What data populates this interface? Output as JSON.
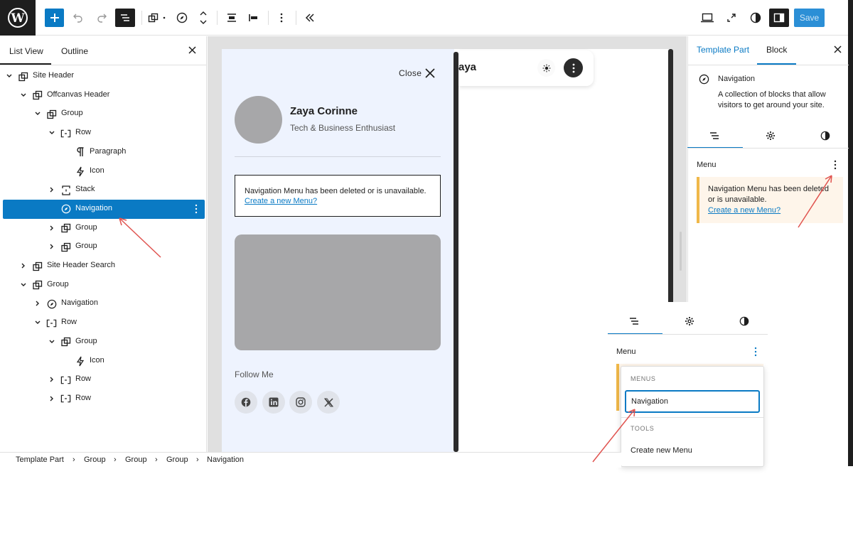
{
  "toolbar": {
    "save_label": "Save",
    "icons": [
      "wordpress-logo-icon",
      "plus-icon",
      "undo-icon",
      "redo-icon",
      "list-view-icon",
      "block-type-icon",
      "navigation-compass-icon",
      "move-arrows-icon",
      "justify-icon",
      "align-icon",
      "more-vertical-icon",
      "collapse-icon",
      "desktop-preview-icon",
      "external-link-icon",
      "contrast-icon",
      "sidebar-icon"
    ]
  },
  "left_panel": {
    "tabs": [
      "List View",
      "Outline"
    ],
    "tree": [
      {
        "label": "Site Header",
        "icon": "template-part-icon",
        "chevron": "down"
      },
      {
        "label": "Offcanvas Header",
        "icon": "group-icon",
        "chevron": "down"
      },
      {
        "label": "Group",
        "icon": "group-icon",
        "chevron": "down"
      },
      {
        "label": "Row",
        "icon": "row-icon",
        "chevron": "down"
      },
      {
        "label": "Paragraph",
        "icon": "paragraph-icon",
        "chevron": ""
      },
      {
        "label": "Icon",
        "icon": "bolt-icon",
        "chevron": ""
      },
      {
        "label": "Stack",
        "icon": "stack-icon",
        "chevron": "right"
      },
      {
        "label": "Navigation",
        "icon": "navigation-compass-icon",
        "chevron": "",
        "selected": true
      },
      {
        "label": "Group",
        "icon": "group-icon",
        "chevron": "right"
      },
      {
        "label": "Group",
        "icon": "group-icon",
        "chevron": "right"
      },
      {
        "label": "Site Header Search",
        "icon": "group-icon",
        "chevron": "right"
      },
      {
        "label": "Group",
        "icon": "group-icon",
        "chevron": "down"
      },
      {
        "label": "Navigation",
        "icon": "navigation-compass-icon",
        "chevron": "right"
      },
      {
        "label": "Row",
        "icon": "row-icon",
        "chevron": "down"
      },
      {
        "label": "Group",
        "icon": "group-icon",
        "chevron": "down"
      },
      {
        "label": "Icon",
        "icon": "bolt-icon",
        "chevron": ""
      },
      {
        "label": "Row",
        "icon": "row-icon",
        "chevron": "right"
      },
      {
        "label": "Row",
        "icon": "row-icon",
        "chevron": "right"
      }
    ]
  },
  "canvas": {
    "header_name": "aya",
    "close_label": "Close",
    "profile_name": "Zaya Corinne",
    "profile_title": "Tech & Business Enthusiast",
    "notice_text": "Navigation Menu has been deleted or is unavailable.",
    "notice_link": "Create a new Menu?",
    "follow_label": "Follow Me",
    "social_icons": [
      "facebook-icon",
      "linkedin-icon",
      "instagram-icon",
      "x-icon"
    ]
  },
  "right_panel": {
    "tabs": [
      "Template Part",
      "Block"
    ],
    "block_title": "Navigation",
    "block_description": "A collection of blocks that allow visitors to get around your site.",
    "menu_label": "Menu",
    "warning_text": "Navigation Menu has been deleted or is unavailable.",
    "warning_link": "Create a new Menu?"
  },
  "popover": {
    "menu_label": "Menu",
    "menus_heading": "MENUS",
    "menu_item": "Navigation",
    "tools_heading": "TOOLS",
    "tools_item": "Create new Menu"
  },
  "breadcrumb": [
    "Template Part",
    "Group",
    "Group",
    "Group",
    "Navigation"
  ],
  "colors": {
    "accent": "#0a7ac4",
    "warning": "#f0b849",
    "annotation": "#e0534f"
  }
}
